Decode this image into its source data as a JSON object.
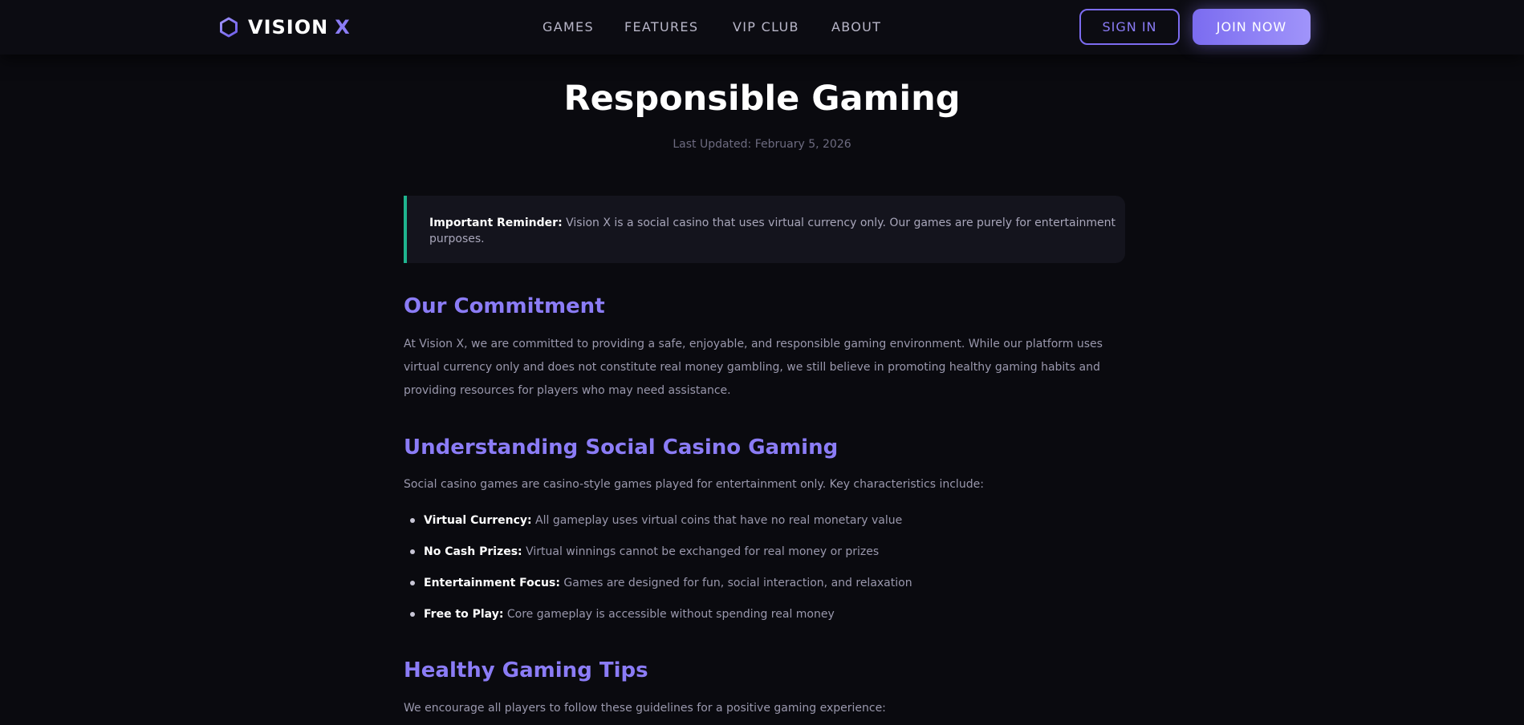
{
  "header": {
    "logo": {
      "icon": "hexagon-icon",
      "text": "VISION",
      "accent": "X"
    },
    "nav": [
      {
        "label": "GAMES"
      },
      {
        "label": "FEATURES"
      },
      {
        "label": "VIP CLUB"
      },
      {
        "label": "ABOUT"
      }
    ],
    "sign_in_label": "SIGN IN",
    "join_label": "JOIN NOW"
  },
  "main": {
    "title": "Responsible Gaming",
    "last_updated": "Last Updated: February 5, 2026",
    "callout": {
      "strong": "Important Reminder:",
      "text": " Vision X is a social casino that uses virtual currency only. Our games are purely for entertainment purposes."
    },
    "sections": [
      {
        "heading": "Our Commitment",
        "paragraph": "At Vision X, we are committed to providing a safe, enjoyable, and responsible gaming environment. While our platform uses virtual currency only and does not constitute real money gambling, we still believe in promoting healthy gaming habits and providing resources for players who may need assistance."
      },
      {
        "heading": "Understanding Social Casino Gaming",
        "paragraph": "Social casino games are casino-style games played for entertainment only. Key characteristics include:",
        "items": [
          {
            "strong": "Virtual Currency:",
            "text": " All gameplay uses virtual coins that have no real monetary value"
          },
          {
            "strong": "No Cash Prizes:",
            "text": " Virtual winnings cannot be exchanged for real money or prizes"
          },
          {
            "strong": "Entertainment Focus:",
            "text": " Games are designed for fun, social interaction, and relaxation"
          },
          {
            "strong": "Free to Play:",
            "text": " Core gameplay is accessible without spending real money"
          }
        ]
      },
      {
        "heading": "Healthy Gaming Tips",
        "paragraph": "We encourage all players to follow these guidelines for a positive gaming experience:"
      }
    ]
  },
  "colors": {
    "background": "#0a0a0f",
    "accent": "#8b7cf6",
    "callout_border": "#1fb58f"
  }
}
